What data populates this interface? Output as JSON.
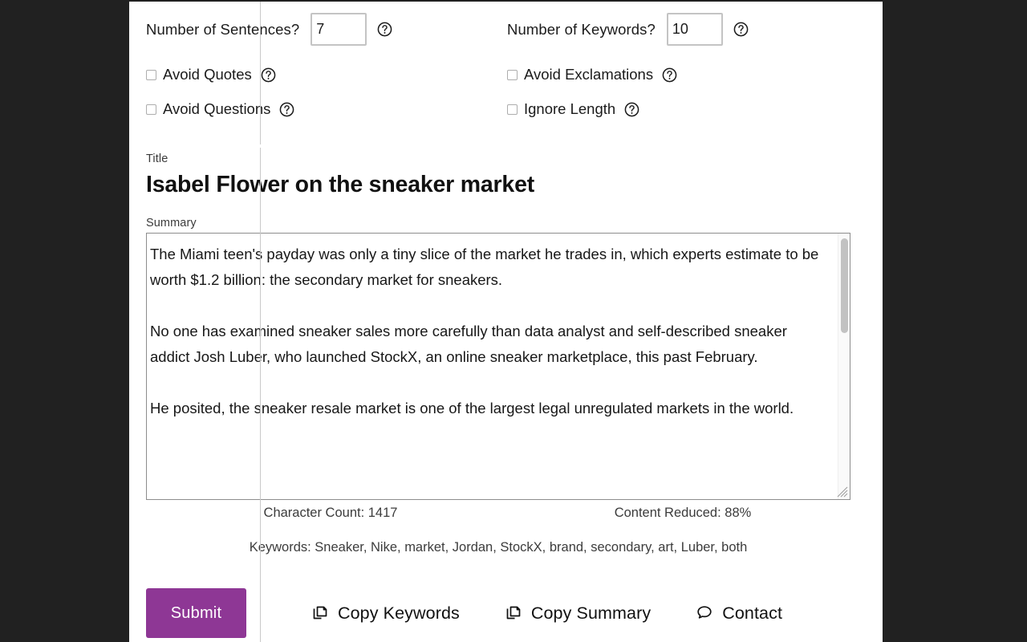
{
  "options": {
    "sentences": {
      "label": "Number of Sentences?",
      "value": "7",
      "placeholder": "",
      "help_icon": "help-circle-icon"
    },
    "keywords": {
      "label": "Number of Keywords?",
      "value": "10",
      "placeholder": "",
      "help_icon": "help-circle-icon"
    },
    "checkboxes": [
      {
        "label": "Avoid Quotes",
        "checked": false,
        "help_icon": "help-circle-icon"
      },
      {
        "label": "Avoid Exclamations",
        "checked": false,
        "help_icon": "help-circle-icon"
      },
      {
        "label": "Avoid Questions",
        "checked": false,
        "help_icon": "help-circle-icon"
      },
      {
        "label": "Ignore Length",
        "checked": false,
        "help_icon": "help-circle-icon"
      }
    ]
  },
  "title": {
    "label": "Title",
    "value": "Isabel Flower on the sneaker market"
  },
  "summary": {
    "label": "Summary",
    "value": "The Miami teen's payday was only a tiny slice of the market he trades in, which experts estimate to be worth $1.2 billion: the secondary market for sneakers.\n\nNo one has examined sneaker sales more carefully than data analyst and self-described sneaker addict Josh Luber, who launched StockX, an online sneaker marketplace, this past February.\n\nHe posited, the sneaker resale market is one of the largest legal unregulated markets in the world."
  },
  "stats": {
    "character_count": "Character Count: 1417",
    "content_reduced": "Content Reduced: 88%",
    "keywords_line": "Keywords: Sneaker, Nike, market, Jordan, StockX, brand, secondary, art, Luber, both"
  },
  "actions": {
    "submit": "Submit",
    "copy_keywords": "Copy Keywords",
    "copy_summary": "Copy Summary",
    "contact": "Contact",
    "copy_icon": "copy-icon",
    "contact_icon": "speech-bubble-icon"
  },
  "colors": {
    "submit_background": "#8e3795",
    "submit_text": "#ffffff",
    "page_background": "#ffffff",
    "desktop_background": "#212121",
    "input_border": "#c4c4c4",
    "textarea_border": "#8d8d8d",
    "scrollbar_thumb": "#c2c2c2"
  }
}
